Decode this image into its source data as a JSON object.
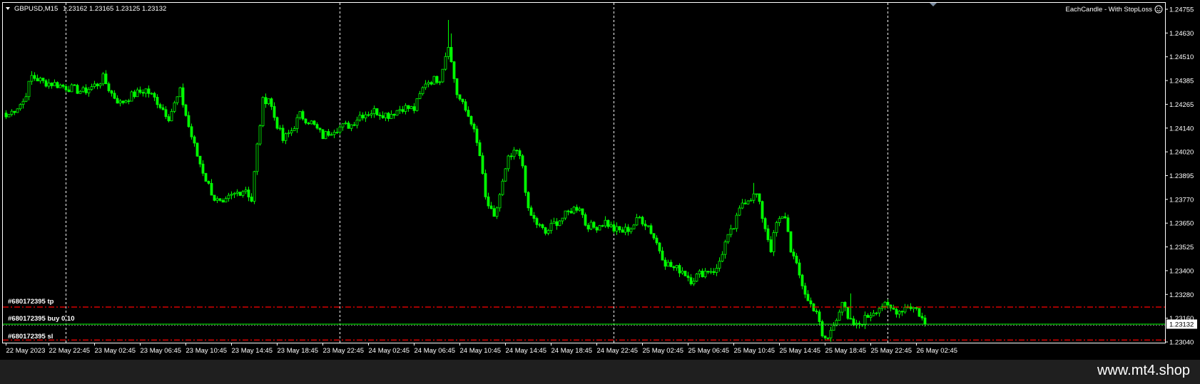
{
  "header": {
    "symbol": "GBPUSD,M15",
    "ohlc": "1.23162 1.23165 1.23125 1.23132",
    "indicator_label": "EachCandle - With StopLoss",
    "indicator_icon": "smiley-icon"
  },
  "order_labels": {
    "tp": "#680172395 tp",
    "buy": "#680172395 buy 0.10",
    "sl": "#680172395 sl"
  },
  "footer": {
    "watermark": "www.mt4.shop"
  },
  "colors": {
    "background": "#000000",
    "candle": "#00ff00",
    "grid": "#ffffff",
    "axis_text": "#ffffff",
    "tp_line": "#ff0000",
    "sl_line": "#ff0000",
    "entry_line": "#00ff00",
    "price_tag_bg": "#ffffff"
  },
  "chart_data": {
    "type": "candlestick",
    "symbol": "GBPUSD",
    "timeframe": "M15",
    "y_ticks": [
      "1.24755",
      "1.24630",
      "1.24510",
      "1.24385",
      "1.24265",
      "1.24140",
      "1.24020",
      "1.23895",
      "1.23770",
      "1.23650",
      "1.23525",
      "1.23400",
      "1.23280",
      "1.23160",
      "1.23040"
    ],
    "ylim": [
      1.2304,
      1.24755
    ],
    "current_price": "1.23132",
    "x_ticks": [
      "22 May 2023",
      "22 May 22:45",
      "23 May 02:45",
      "23 May 06:45",
      "23 May 10:45",
      "23 May 14:45",
      "23 May 18:45",
      "23 May 22:45",
      "24 May 02:45",
      "24 May 06:45",
      "24 May 10:45",
      "24 May 14:45",
      "24 May 18:45",
      "24 May 22:45",
      "25 May 02:45",
      "25 May 06:45",
      "25 May 10:45",
      "25 May 14:45",
      "25 May 18:45",
      "25 May 22:45",
      "26 May 02:45"
    ],
    "x_ticks_candle_index": [
      0,
      15,
      31,
      47,
      63,
      79,
      95,
      111,
      127,
      143,
      159,
      175,
      191,
      207,
      223,
      239,
      255,
      271,
      287,
      303,
      319
    ],
    "day_separators_candle_index": [
      21,
      117,
      213,
      309
    ],
    "candle_count": 323,
    "price_anchors": [
      [
        0,
        1.242
      ],
      [
        6,
        1.2428
      ],
      [
        9,
        1.2441
      ],
      [
        13,
        1.2438
      ],
      [
        17,
        1.2437
      ],
      [
        22,
        1.2435
      ],
      [
        27,
        1.2433
      ],
      [
        32,
        1.2437
      ],
      [
        34,
        1.244
      ],
      [
        37,
        1.2432
      ],
      [
        40,
        1.2427
      ],
      [
        44,
        1.2431
      ],
      [
        49,
        1.2434
      ],
      [
        53,
        1.2428
      ],
      [
        57,
        1.242
      ],
      [
        61,
        1.2433
      ],
      [
        64,
        1.2415
      ],
      [
        67,
        1.24
      ],
      [
        70,
        1.2388
      ],
      [
        73,
        1.2378
      ],
      [
        76,
        1.2374
      ],
      [
        78,
        1.2378
      ],
      [
        81,
        1.2381
      ],
      [
        84,
        1.2383
      ],
      [
        86,
        1.2377
      ],
      [
        88,
        1.2405
      ],
      [
        90,
        1.2428
      ],
      [
        92,
        1.243
      ],
      [
        94,
        1.242
      ],
      [
        97,
        1.2408
      ],
      [
        100,
        1.2413
      ],
      [
        103,
        1.2421
      ],
      [
        107,
        1.2417
      ],
      [
        111,
        1.241
      ],
      [
        115,
        1.2414
      ],
      [
        121,
        1.2416
      ],
      [
        124,
        1.2421
      ],
      [
        129,
        1.2423
      ],
      [
        134,
        1.2421
      ],
      [
        139,
        1.2425
      ],
      [
        143,
        1.2424
      ],
      [
        147,
        1.2438
      ],
      [
        152,
        1.244
      ],
      [
        155,
        1.2458
      ],
      [
        156,
        1.2448
      ],
      [
        158,
        1.2432
      ],
      [
        160,
        1.2426
      ],
      [
        163,
        1.2418
      ],
      [
        166,
        1.24
      ],
      [
        168,
        1.2378
      ],
      [
        171,
        1.2367
      ],
      [
        173,
        1.238
      ],
      [
        176,
        1.2398
      ],
      [
        179,
        1.2402
      ],
      [
        181,
        1.2395
      ],
      [
        183,
        1.2371
      ],
      [
        186,
        1.2365
      ],
      [
        189,
        1.236
      ],
      [
        192,
        1.2365
      ],
      [
        195,
        1.2368
      ],
      [
        198,
        1.2372
      ],
      [
        201,
        1.2374
      ],
      [
        203,
        1.2365
      ],
      [
        206,
        1.2363
      ],
      [
        210,
        1.2366
      ],
      [
        213,
        1.2362
      ],
      [
        216,
        1.2361
      ],
      [
        219,
        1.2363
      ],
      [
        222,
        1.2368
      ],
      [
        225,
        1.2364
      ],
      [
        228,
        1.2355
      ],
      [
        231,
        1.2345
      ],
      [
        234,
        1.2342
      ],
      [
        237,
        1.2341
      ],
      [
        240,
        1.2336
      ],
      [
        243,
        1.2339
      ],
      [
        246,
        1.2341
      ],
      [
        249,
        1.2341
      ],
      [
        252,
        1.2355
      ],
      [
        255,
        1.2363
      ],
      [
        258,
        1.2376
      ],
      [
        260,
        1.2378
      ],
      [
        263,
        1.238
      ],
      [
        266,
        1.2363
      ],
      [
        268,
        1.2352
      ],
      [
        270,
        1.2365
      ],
      [
        273,
        1.2369
      ],
      [
        275,
        1.2352
      ],
      [
        278,
        1.2338
      ],
      [
        281,
        1.2325
      ],
      [
        284,
        1.232
      ],
      [
        286,
        1.2306
      ],
      [
        288,
        1.2306
      ],
      [
        290,
        1.2313
      ],
      [
        293,
        1.2325
      ],
      [
        295,
        1.2315
      ],
      [
        298,
        1.2312
      ],
      [
        301,
        1.2316
      ],
      [
        304,
        1.232
      ],
      [
        307,
        1.2323
      ],
      [
        310,
        1.2321
      ],
      [
        313,
        1.232
      ],
      [
        316,
        1.2323
      ],
      [
        319,
        1.2321
      ],
      [
        321,
        1.2316
      ],
      [
        322,
        1.23132
      ]
    ],
    "spikes": [
      [
        155,
        1.247
      ],
      [
        156,
        1.2463
      ],
      [
        246,
        1.2339
      ],
      [
        262,
        1.2386
      ],
      [
        288,
        1.2306
      ],
      [
        296,
        1.2329
      ]
    ],
    "tp_price": 1.2322,
    "entry_price": 1.23132,
    "sl_price": 1.2305
  }
}
